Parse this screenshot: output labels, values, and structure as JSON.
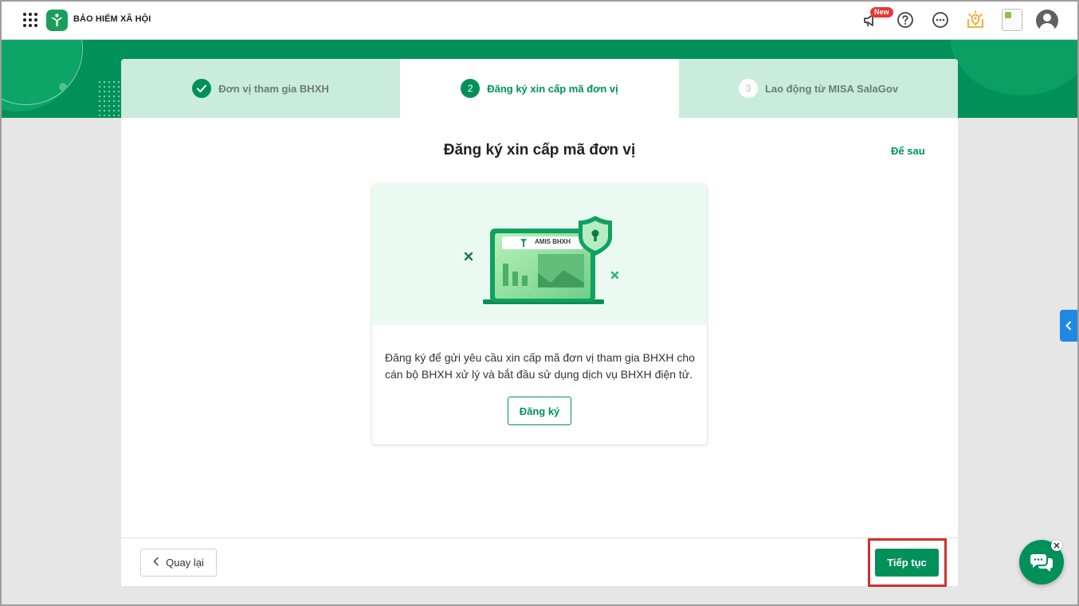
{
  "app": {
    "title": "BẢO HIỂM XÃ HỘI",
    "new_badge": "New"
  },
  "header_icons": [
    "apps-grid-icon",
    "megaphone-icon",
    "help-icon",
    "more-icon",
    "location-icon",
    "profile-image",
    "user-avatar-icon"
  ],
  "steps": [
    {
      "number": "1",
      "label": "Đơn vị tham gia BHXH",
      "state": "done"
    },
    {
      "number": "2",
      "label": "Đăng ký xin cấp mã đơn vị",
      "state": "current"
    },
    {
      "number": "3",
      "label": "Lao động từ MISA SalaGov",
      "state": "pending"
    }
  ],
  "main": {
    "title": "Đăng ký xin cấp mã đơn vị",
    "later_link": "Để sau",
    "illustration_label": "AMIS BHXH",
    "description": "Đăng ký để gửi yêu cầu xin cấp mã đơn vị tham gia BHXH cho cán bộ BHXH xử lý và bắt đầu sử dụng dịch vụ BHXH điện tử.",
    "register_button": "Đăng ký"
  },
  "footer": {
    "back_button": "Quay lại",
    "next_button": "Tiếp tục"
  },
  "colors": {
    "primary": "#00915a",
    "step_inactive_bg": "#c9ecdc",
    "highlight": "#d32f2f",
    "side_tab": "#1e88e5"
  }
}
